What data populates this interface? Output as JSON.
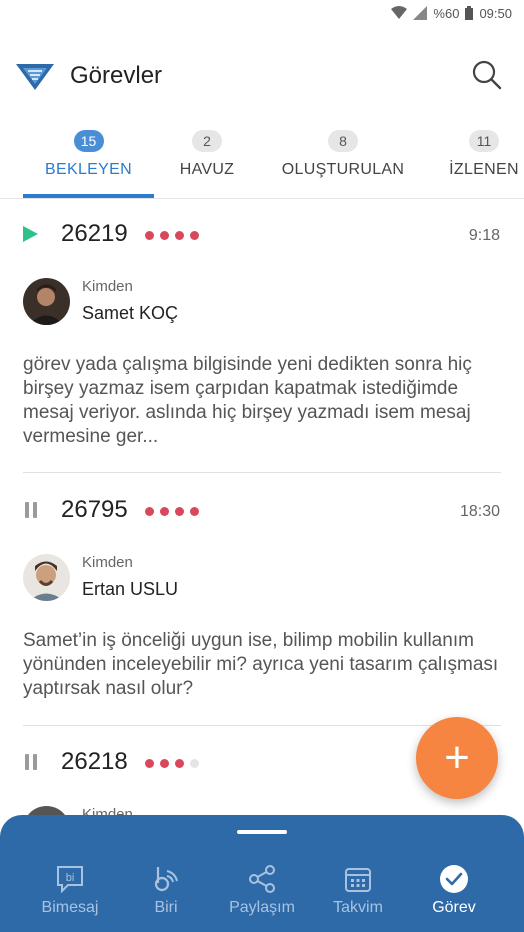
{
  "status_bar": {
    "battery": "%60",
    "time": "09:50"
  },
  "header": {
    "title": "Görevler"
  },
  "tabs": [
    {
      "label": "BEKLEYEN",
      "count": "15",
      "active": true
    },
    {
      "label": "HAVUZ",
      "count": "2",
      "active": false
    },
    {
      "label": "OLUŞTURULAN",
      "count": "8",
      "active": false
    },
    {
      "label": "İZLENEN",
      "count": "11",
      "active": false
    }
  ],
  "tasks": [
    {
      "id": "26219",
      "state": "playing",
      "priority": 4,
      "time": "9:18",
      "from_label": "Kimden",
      "from_name": "Samet KOÇ",
      "message": "görev yada çalışma bilgisinde yeni dedikten sonra hiç birşey yazmaz isem çarpıdan kapatmak istediğimde mesaj veriyor. aslında hiç birşey yazmadı isem mesaj vermesine ger..."
    },
    {
      "id": "26795",
      "state": "paused",
      "priority": 4,
      "time": "18:30",
      "from_label": "Kimden",
      "from_name": "Ertan USLU",
      "message": "Samet’in iş önceliği uygun ise, bilimp mobilin kullanım yönünden inceleyebilir mi? ayrıca yeni tasarım çalışması yaptırsak nasıl olur?"
    },
    {
      "id": "26218",
      "state": "paused",
      "priority": 3,
      "time": "",
      "from_label": "Kimden",
      "from_name": ""
    }
  ],
  "fab": {
    "icon": "plus-icon"
  },
  "bottom_nav": [
    {
      "label": "Bimesaj",
      "icon": "bi-chat-icon",
      "active": false
    },
    {
      "label": "Biri",
      "icon": "biri-icon",
      "active": false
    },
    {
      "label": "Paylaşım",
      "icon": "share-icon",
      "active": false
    },
    {
      "label": "Takvim",
      "icon": "calendar-icon",
      "active": false
    },
    {
      "label": "Görev",
      "icon": "check-circle-icon",
      "active": true
    }
  ],
  "colors": {
    "accent": "#2b7bd0",
    "fab": "#f58540",
    "nav_bg": "#2f6aa8",
    "priority": "#d9475b",
    "play": "#2ec28b"
  }
}
